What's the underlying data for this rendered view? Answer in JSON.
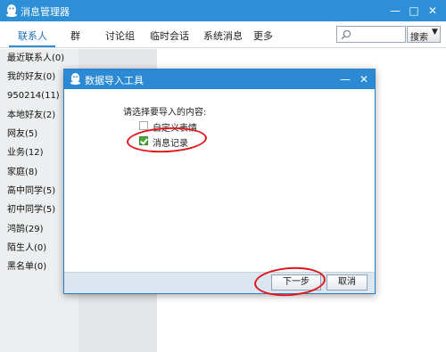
{
  "window": {
    "title": "消息管理器",
    "min": "—",
    "max": "□",
    "close": "✕"
  },
  "tabs": [
    {
      "label": "联系人"
    },
    {
      "label": "群"
    },
    {
      "label": "讨论组"
    },
    {
      "label": "临时会话"
    },
    {
      "label": "系统消息"
    },
    {
      "label": "更多"
    }
  ],
  "search": {
    "value": "",
    "placeholder": "",
    "button_label": "搜索",
    "dropdown_glyph": "▼"
  },
  "sidebar": {
    "items": [
      {
        "label": "最近联系人(0)"
      },
      {
        "label": "我的好友(0)"
      },
      {
        "label": "950214(11)"
      },
      {
        "label": "本地好友(2)"
      },
      {
        "label": "网友(5)"
      },
      {
        "label": "业务(12)"
      },
      {
        "label": "家庭(8)"
      },
      {
        "label": "高中同学(5)"
      },
      {
        "label": "初中同学(5)"
      },
      {
        "label": "鸿鹄(29)"
      },
      {
        "label": "陌生人(0)"
      },
      {
        "label": "黑名单(0)"
      }
    ]
  },
  "dialog": {
    "title": "数据导入工具",
    "min": "—",
    "close": "✕",
    "prompt": "请选择要导入的内容:",
    "options": [
      {
        "label": "自定义表情",
        "checked": false
      },
      {
        "label": "消息记录",
        "checked": true
      }
    ],
    "next_label": "下一步",
    "cancel_label": "取消"
  },
  "colors": {
    "titlebar": "#2d8fd6",
    "annotation": "#e0151b",
    "checkbox_checked": "#4ea63a"
  }
}
